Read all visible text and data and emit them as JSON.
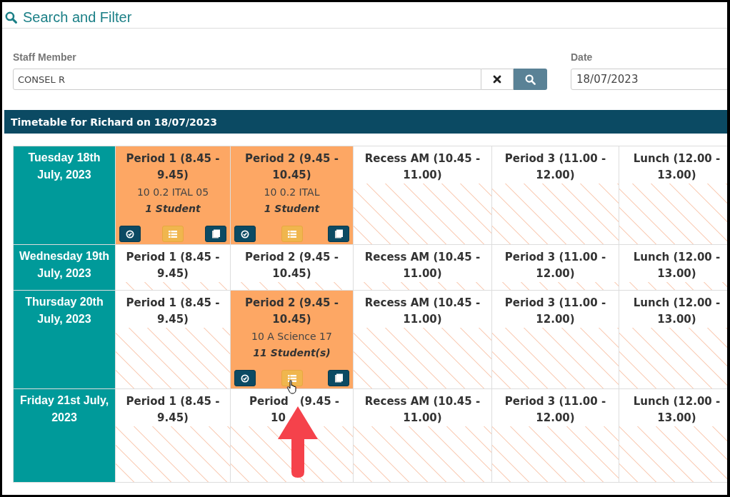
{
  "panel": {
    "title": "Search and Filter"
  },
  "filters": {
    "staff": {
      "label": "Staff Member",
      "value": "CONSEL R"
    },
    "date": {
      "label": "Date",
      "value": "18/07/2023"
    }
  },
  "timetable": {
    "title": "Timetable for Richard on 18/07/2023",
    "days": [
      {
        "label": "Tuesday 18th July, 2023",
        "cells": [
          {
            "kind": "booked",
            "title": "Period 1 (8.45 - 9.45)",
            "class": "10 0.2 ITAL 05",
            "students": "1 Student"
          },
          {
            "kind": "booked",
            "title": "Period 2 (9.45 - 10.45)",
            "class": "10 0.2 ITAL",
            "students": "1 Student"
          },
          {
            "kind": "free",
            "title": "Recess AM (10.45 - 11.00)"
          },
          {
            "kind": "free",
            "title": "Period 3 (11.00 - 12.00)"
          },
          {
            "kind": "free",
            "title": "Lunch (12.00 - 13.00)"
          }
        ]
      },
      {
        "label": "Wednesday 19th July, 2023",
        "cells": [
          {
            "kind": "free",
            "title": "Period 1 (8.45 - 9.45)"
          },
          {
            "kind": "free",
            "title": "Period 2 (9.45 - 10.45)"
          },
          {
            "kind": "free",
            "title": "Recess AM (10.45 - 11.00)"
          },
          {
            "kind": "free",
            "title": "Period 3 (11.00 - 12.00)"
          },
          {
            "kind": "free",
            "title": "Lunch (12.00 - 13.00)"
          }
        ]
      },
      {
        "label": "Thursday 20th July, 2023",
        "cells": [
          {
            "kind": "free",
            "title": "Period 1 (8.45 - 9.45)"
          },
          {
            "kind": "booked",
            "title": "Period 2 (9.45 - 10.45)",
            "class": "10 A Science 17",
            "students": "11 Student(s)"
          },
          {
            "kind": "free",
            "title": "Recess AM (10.45 - 11.00)"
          },
          {
            "kind": "free",
            "title": "Period 3 (11.00 - 12.00)"
          },
          {
            "kind": "free",
            "title": "Lunch (12.00 - 13.00)"
          }
        ]
      },
      {
        "label": "Friday 21st July, 2023",
        "cells": [
          {
            "kind": "free",
            "title": "Period 1 (8.45 - 9.45)"
          },
          {
            "kind": "obscured",
            "title_parts": [
              "Period",
              "(9.45 -",
              "10"
            ]
          },
          {
            "kind": "free",
            "title": "Recess AM (10.45 - 11.00)"
          },
          {
            "kind": "free",
            "title": "Period 3 (11.00 - 12.00)"
          },
          {
            "kind": "free",
            "title": "Lunch (12.00 - 13.00)"
          }
        ]
      }
    ]
  }
}
